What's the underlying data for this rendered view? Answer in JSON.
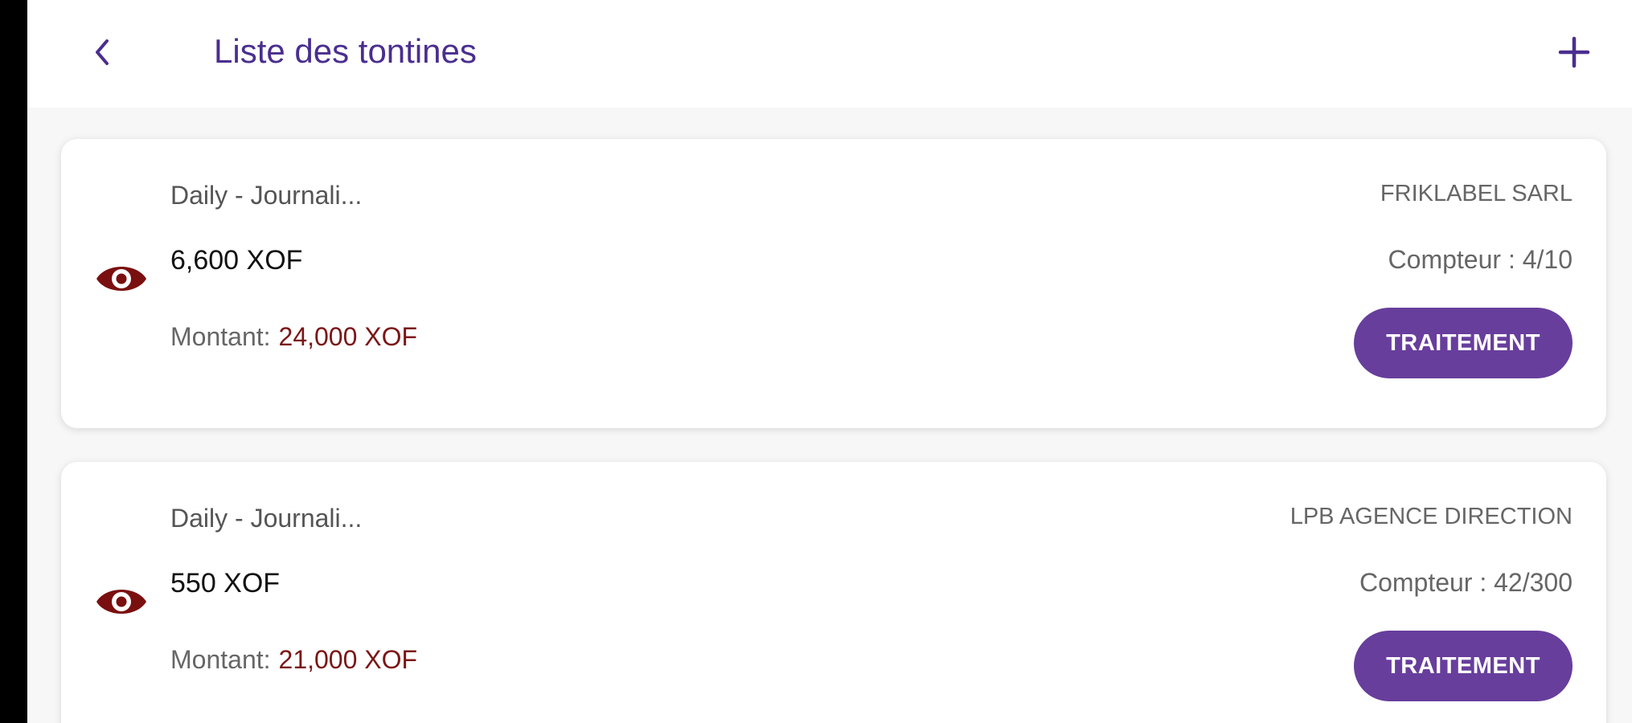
{
  "header": {
    "back_icon": "chevron-left-icon",
    "title": "Liste des tontines",
    "add_icon": "plus-icon"
  },
  "colors": {
    "title": "#4a2e8f",
    "accent_button": "#673e9c",
    "montant_value": "#7b1616",
    "eye_icon": "#7a0f0f"
  },
  "tontines": [
    {
      "view_icon": "eye-icon",
      "frequency": "Daily - Journali...",
      "amount": "6,600 XOF",
      "montant_label": "Montant:",
      "montant_value": "24,000 XOF",
      "agency": "FRIKLABEL SARL",
      "counter": "Compteur : 4/10",
      "action_label": "TRAITEMENT"
    },
    {
      "view_icon": "eye-icon",
      "frequency": "Daily - Journali...",
      "amount": "550 XOF",
      "montant_label": "Montant:",
      "montant_value": "21,000 XOF",
      "agency": "LPB AGENCE DIRECTION",
      "counter": "Compteur : 42/300",
      "action_label": "TRAITEMENT"
    }
  ]
}
